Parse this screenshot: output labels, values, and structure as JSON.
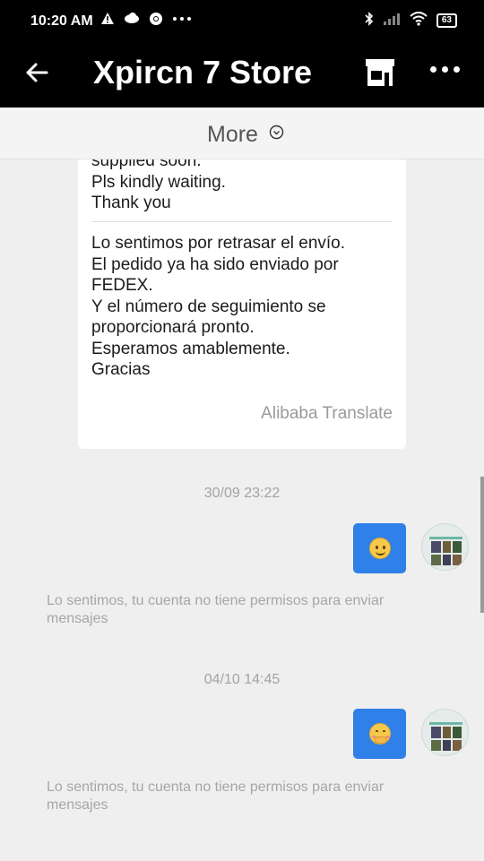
{
  "status": {
    "time": "10:20 AM",
    "battery": "63"
  },
  "header": {
    "title": "Xpircn 7 Store",
    "icons": [
      "back-arrow-icon",
      "store-icon",
      "more-options-icon"
    ]
  },
  "more_bar": {
    "label": "More"
  },
  "message_card": {
    "original_lines": [
      "supplied soon.",
      "Pls kindly waiting.",
      "Thank you"
    ],
    "translated_lines": [
      "Lo sentimos por retrasar el envío.",
      "El pedido ya ha sido enviado por",
      "FEDEX.",
      "Y el número de seguimiento se",
      "proporcionará pronto.",
      "Esperamos amablemente.",
      "Gracias"
    ],
    "translator": "Alibaba Translate"
  },
  "thread": [
    {
      "timestamp": "30/09 23:22",
      "emoji": "smiling-face-emoji",
      "notice": "Lo sentimos, tu cuenta no tiene permisos para enviar mensajes"
    },
    {
      "timestamp": "04/10 14:45",
      "emoji": "hand-over-mouth-emoji",
      "notice": "Lo sentimos, tu cuenta no tiene permisos para enviar mensajes"
    }
  ],
  "colors": {
    "bubble": "#2f80e8",
    "header": "#000000",
    "background": "#efefef"
  }
}
